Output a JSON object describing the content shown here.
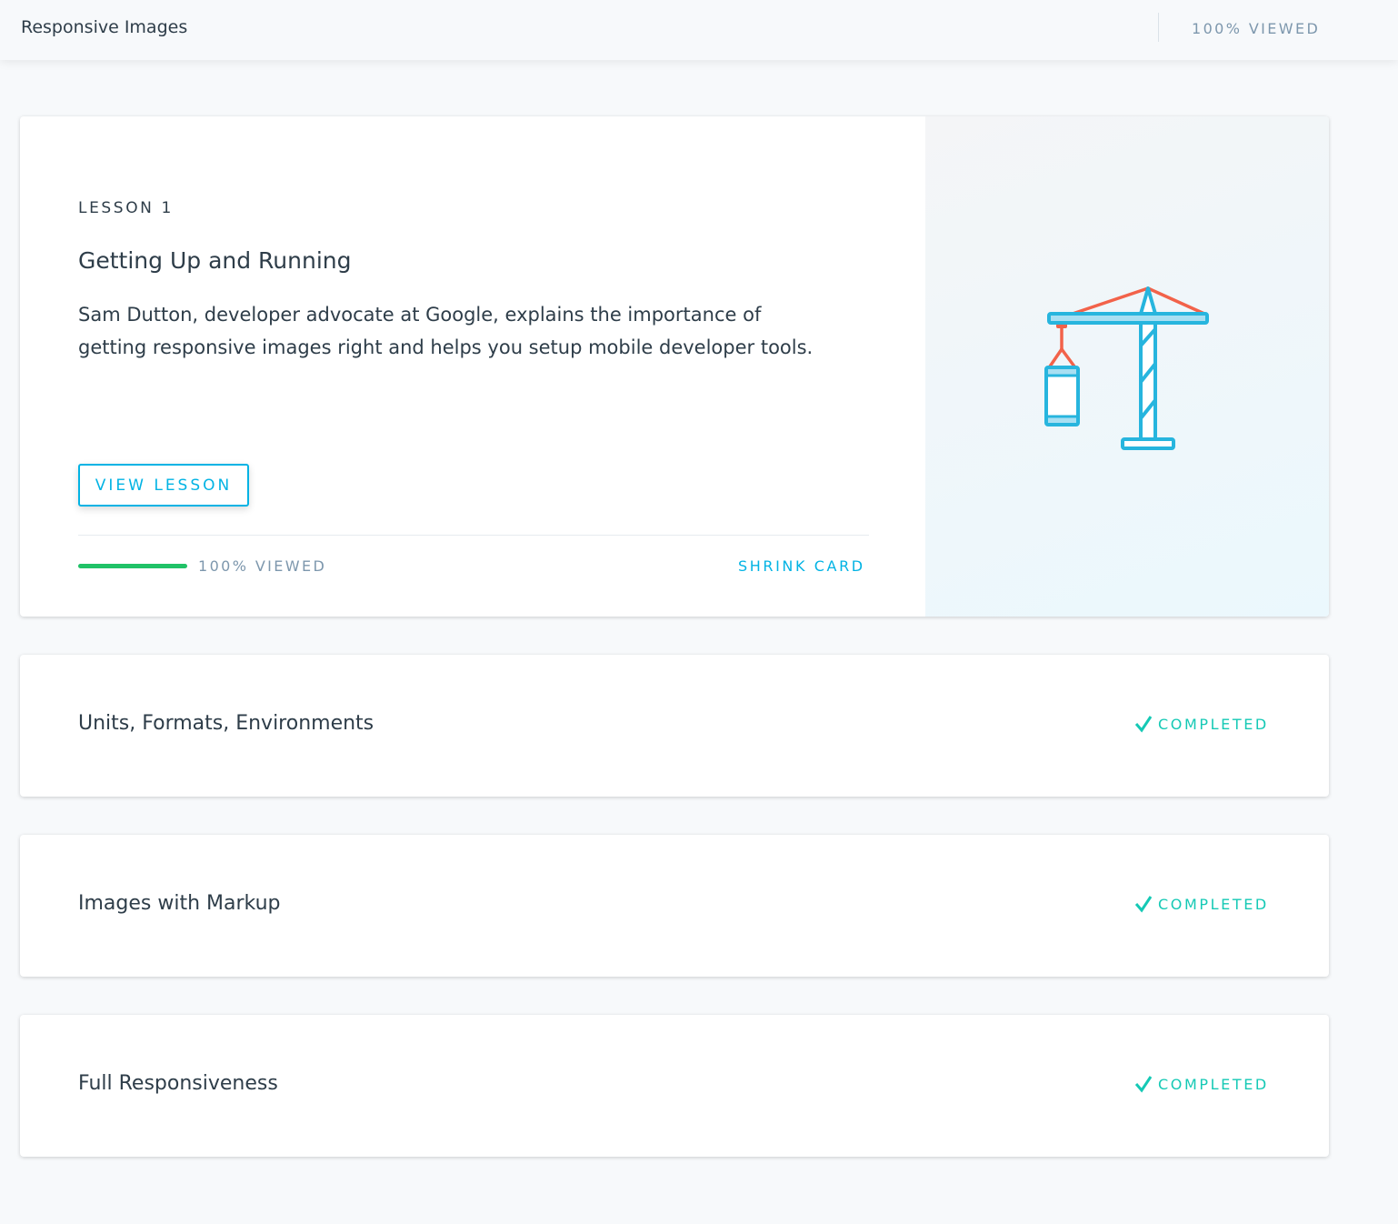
{
  "header": {
    "title": "Responsive Images",
    "viewed": "100% VIEWED"
  },
  "current_lesson": {
    "number": "LESSON 1",
    "title": "Getting Up and Running",
    "description": "Sam Dutton, developer advocate at Google, explains the importance of getting responsive images right and helps you setup mobile developer tools.",
    "button": "VIEW LESSON",
    "progress_percent": 100,
    "progress_label": "100% VIEWED",
    "shrink": "SHRINK CARD",
    "illustration": "crane-icon"
  },
  "lessons": [
    {
      "title": "Units, Formats, Environments",
      "status": "COMPLETED"
    },
    {
      "title": "Images with Markup",
      "status": "COMPLETED"
    },
    {
      "title": "Full Responsiveness",
      "status": "COMPLETED"
    }
  ],
  "colors": {
    "accent": "#02b3e4",
    "progress": "#20c267",
    "completed": "#15c9b5",
    "crane_red": "#f2624a"
  }
}
